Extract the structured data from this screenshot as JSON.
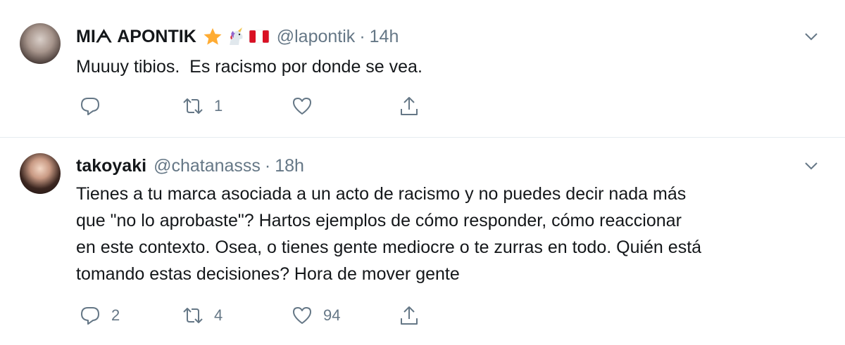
{
  "tweets": [
    {
      "name": "MIᗅ APONTIK",
      "emojis": [
        "star-emoji",
        "unicorn-emoji",
        "peru-flag-emoji"
      ],
      "handle": "@lapontik",
      "time": "14h",
      "text": "Muuuy tibios.  Es racismo por donde se vea.",
      "reply_count": "",
      "retweet_count": "1",
      "like_count": ""
    },
    {
      "name": "takoyaki",
      "emojis": [],
      "handle": "@chatanasss",
      "time": "18h",
      "text": "Tienes a tu marca asociada a un acto de racismo y no puedes decir nada más\nque \"no lo aprobaste\"? Hartos ejemplos de cómo responder, cómo reaccionar\nen este contexto. Osea, o tienes gente mediocre o te zurras en todo. Quién está\ntomando estas decisiones? Hora de mover gente",
      "reply_count": "2",
      "retweet_count": "4",
      "like_count": "94"
    }
  ],
  "colors": {
    "text": "#14171a",
    "muted": "#657786",
    "divider": "#e6ecf0",
    "star": "#ffac33",
    "flag_red": "#d91023"
  },
  "separator": "·"
}
